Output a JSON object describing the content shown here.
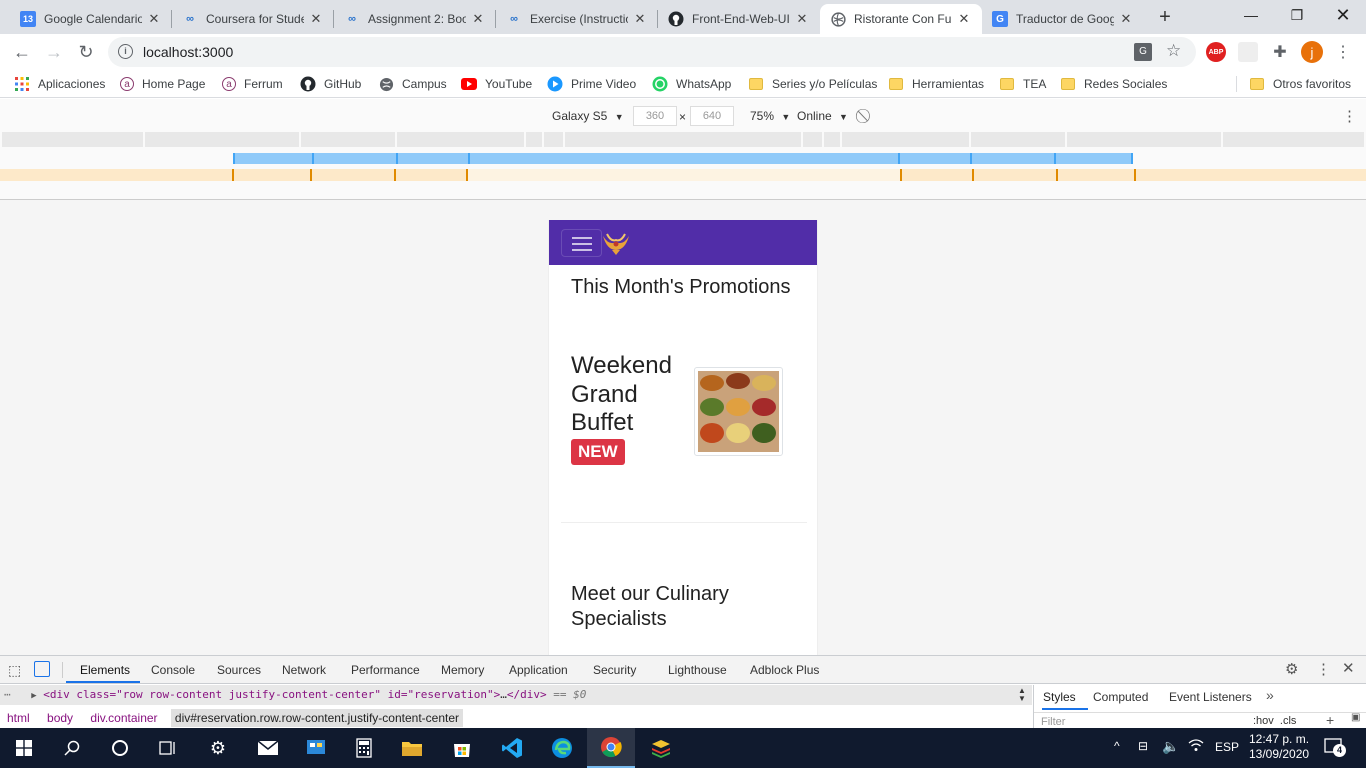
{
  "tabs": [
    {
      "title": "Google Calendario",
      "icon": "calendar-icon",
      "icon_text": "13"
    },
    {
      "title": "Coursera for Stude",
      "icon": "coursera-icon"
    },
    {
      "title": "Assignment 2: Boo",
      "icon": "coursera-icon"
    },
    {
      "title": "Exercise (Instructio",
      "icon": "coursera-icon"
    },
    {
      "title": "Front-End-Web-UI",
      "icon": "github-icon"
    },
    {
      "title": "Ristorante Con Fu",
      "icon": "globe-icon",
      "active": true
    },
    {
      "title": "Traductor de Goog",
      "icon": "google-translate-icon"
    }
  ],
  "address_bar": {
    "url": "localhost:3000"
  },
  "bookmarks": [
    {
      "label": "Aplicaciones",
      "icon": "apps-grid-icon"
    },
    {
      "label": "Home Page",
      "icon": "ferrum-icon"
    },
    {
      "label": "Ferrum",
      "icon": "ferrum-icon"
    },
    {
      "label": "GitHub",
      "icon": "github-icon"
    },
    {
      "label": "Campus",
      "icon": "globe-icon"
    },
    {
      "label": "YouTube",
      "icon": "youtube-icon"
    },
    {
      "label": "Prime Video",
      "icon": "prime-video-icon"
    },
    {
      "label": "WhatsApp",
      "icon": "whatsapp-icon"
    },
    {
      "label": "Series y/o Películas",
      "icon": "folder-icon"
    },
    {
      "label": "Herramientas",
      "icon": "folder-icon"
    },
    {
      "label": "TEA",
      "icon": "folder-icon"
    },
    {
      "label": "Redes Sociales",
      "icon": "folder-icon"
    },
    {
      "label": "Otros favoritos",
      "icon": "folder-icon"
    }
  ],
  "device_toolbar": {
    "device": "Galaxy S5",
    "width": "360",
    "height": "640",
    "separator": "×",
    "zoom": "75%",
    "throttle": "Online"
  },
  "page": {
    "promotions_heading": "This Month's Promotions",
    "item_title": "Weekend Grand Buffet",
    "badge": "NEW",
    "specialists_heading": "Meet our Culinary Specialists",
    "colors": {
      "navbar": "#512da8",
      "badge": "#dc3545"
    }
  },
  "devtools": {
    "tabs": [
      "Elements",
      "Console",
      "Sources",
      "Network",
      "Performance",
      "Memory",
      "Application",
      "Security",
      "Lighthouse",
      "Adblock Plus"
    ],
    "active_tab": "Elements",
    "selected_node": {
      "open": "<div class=\"row row-content justify-content-center\" id=\"reservation\">",
      "ellipsis": "…",
      "close": "</div>",
      "suffix": " == $0"
    },
    "breadcrumbs": [
      "html",
      "body",
      "div.container",
      "div#reservation.row.row-content.justify-content-center"
    ],
    "styles_tabs": [
      "Styles",
      "Computed",
      "Event Listeners"
    ],
    "filter_placeholder": "Filter",
    "pseudo_buttons": ":hov  .cls"
  },
  "taskbar": {
    "language": "ESP",
    "time": "12:47 p. m.",
    "date": "13/09/2020",
    "notifications": "4"
  }
}
